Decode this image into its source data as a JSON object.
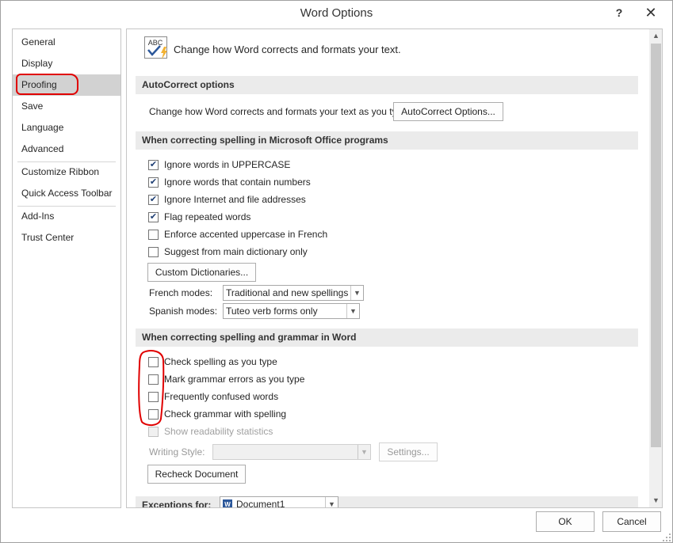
{
  "window": {
    "title": "Word Options",
    "help_label": "?",
    "close_label": "✕"
  },
  "sidebar": {
    "items": [
      {
        "label": "General"
      },
      {
        "label": "Display"
      },
      {
        "label": "Proofing"
      },
      {
        "label": "Save"
      },
      {
        "label": "Language"
      },
      {
        "label": "Advanced"
      },
      {
        "label": "Customize Ribbon"
      },
      {
        "label": "Quick Access Toolbar"
      },
      {
        "label": "Add-Ins"
      },
      {
        "label": "Trust Center"
      }
    ],
    "active": "Proofing"
  },
  "header": {
    "icon_text": "ABC",
    "text": "Change how Word corrects and formats your text."
  },
  "autocorrect": {
    "title": "AutoCorrect options",
    "label": "Change how Word corrects and formats your text as you type:",
    "button": "AutoCorrect Options..."
  },
  "office_spelling": {
    "title": "When correcting spelling in Microsoft Office programs",
    "options": [
      {
        "label": "Ignore words in UPPERCASE",
        "checked": true
      },
      {
        "label": "Ignore words that contain numbers",
        "checked": true
      },
      {
        "label": "Ignore Internet and file addresses",
        "checked": true
      },
      {
        "label": "Flag repeated words",
        "checked": true
      },
      {
        "label": "Enforce accented uppercase in French",
        "checked": false
      },
      {
        "label": "Suggest from main dictionary only",
        "checked": false
      }
    ],
    "custom_dict_button": "Custom Dictionaries...",
    "french_label": "French modes:",
    "french_value": "Traditional and new spellings",
    "spanish_label": "Spanish modes:",
    "spanish_value": "Tuteo verb forms only"
  },
  "word_spelling": {
    "title": "When correcting spelling and grammar in Word",
    "options": [
      {
        "label": "Check spelling as you type",
        "checked": false
      },
      {
        "label": "Mark grammar errors as you type",
        "checked": false
      },
      {
        "label": "Frequently confused words",
        "checked": false
      },
      {
        "label": "Check grammar with spelling",
        "checked": false
      },
      {
        "label": "Show readability statistics",
        "checked": false,
        "disabled": true
      }
    ],
    "writing_style_label": "Writing Style:",
    "writing_style_value": "",
    "settings_button": "Settings...",
    "recheck_button": "Recheck Document"
  },
  "exceptions": {
    "label": "Exceptions for:",
    "document": "Document1"
  },
  "footer": {
    "ok": "OK",
    "cancel": "Cancel"
  },
  "colors": {
    "annotation": "#e00000",
    "active_nav": "#d2d2d2",
    "section_bg": "#ebebeb",
    "check": "#1f3f74"
  },
  "check_glyph": "✔"
}
